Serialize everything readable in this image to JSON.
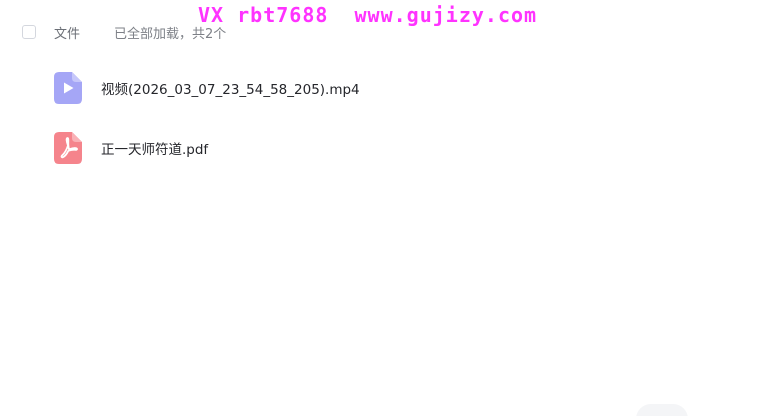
{
  "watermark": {
    "text": "VX rbt7688  www.gujizy.com",
    "color": "#ff33ff"
  },
  "header": {
    "label": "文件",
    "status": "已全部加载，共2个"
  },
  "files": [
    {
      "name": "视频(2026_03_07_23_54_58_205).mp4",
      "icon": "video-file-icon",
      "color": "#a5a6f6"
    },
    {
      "name": "正一天师符道.pdf",
      "icon": "pdf-file-icon",
      "color": "#f5848c"
    }
  ]
}
